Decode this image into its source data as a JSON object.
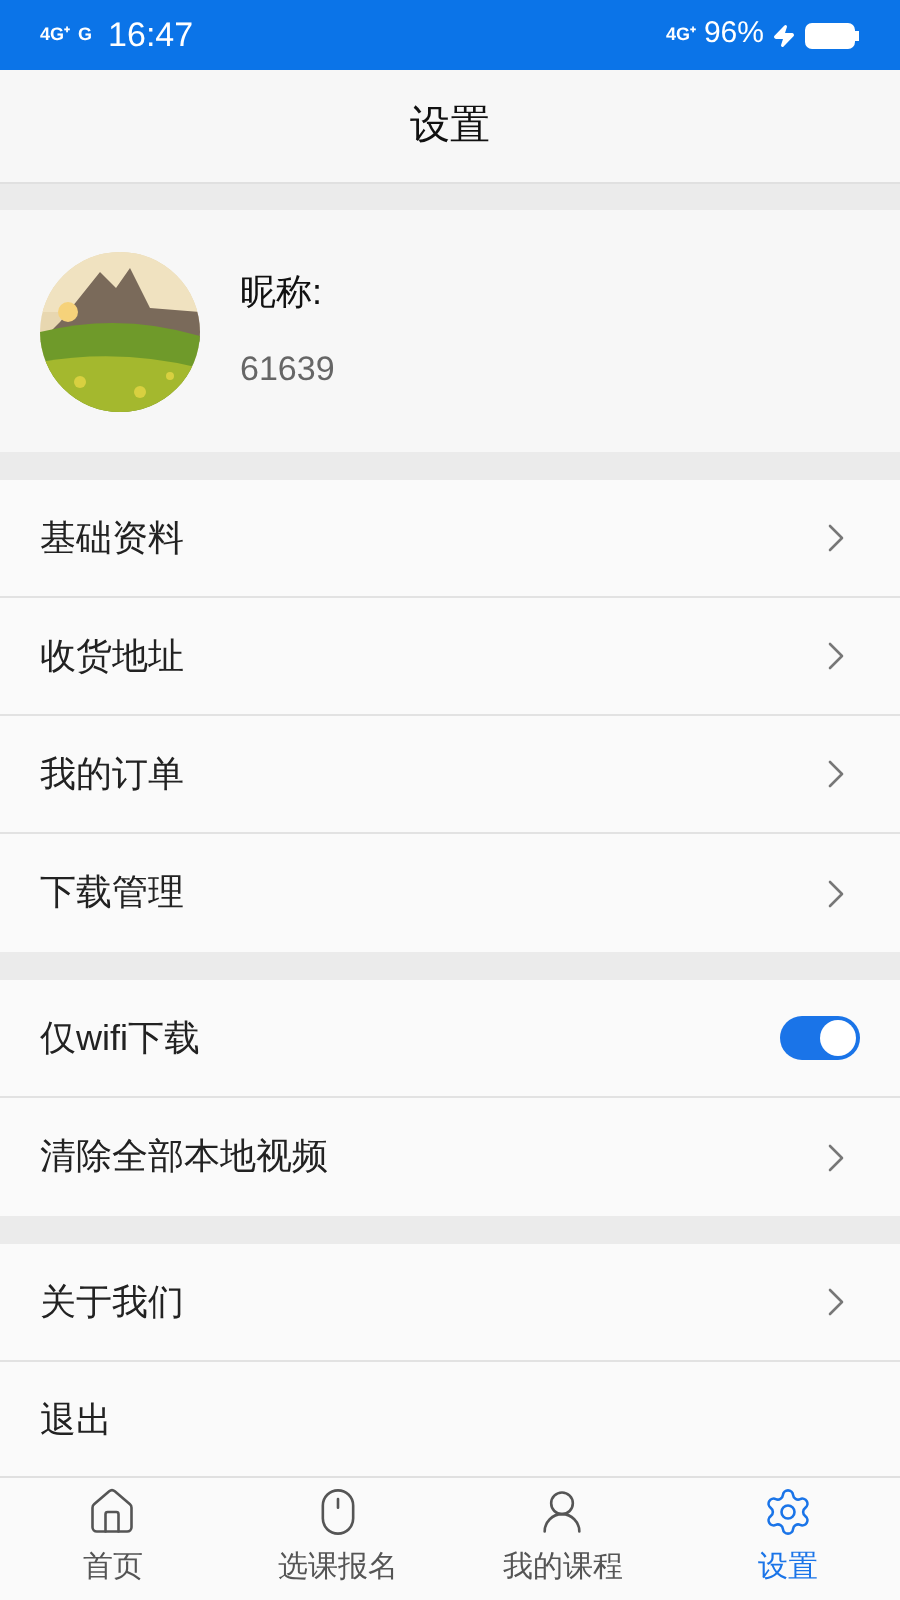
{
  "status_bar": {
    "network_left": "4G⁺",
    "network_right": "G",
    "time": "16:47",
    "network_status": "4G⁺",
    "battery": "96%"
  },
  "header": {
    "title": "设置"
  },
  "profile": {
    "nickname_label": "昵称:",
    "user_id": "61639"
  },
  "groups": [
    {
      "items": [
        {
          "kind": "link",
          "label": "基础资料"
        },
        {
          "kind": "link",
          "label": "收货地址"
        },
        {
          "kind": "link",
          "label": "我的订单"
        },
        {
          "kind": "link",
          "label": "下载管理"
        }
      ]
    },
    {
      "items": [
        {
          "kind": "toggle",
          "label": "仅wifi下载",
          "on": true
        },
        {
          "kind": "link",
          "label": "清除全部本地视频"
        }
      ]
    },
    {
      "items": [
        {
          "kind": "link",
          "label": "关于我们"
        },
        {
          "kind": "plain",
          "label": "退出"
        }
      ]
    }
  ],
  "tab_bar": [
    {
      "label": "首页",
      "selected": false
    },
    {
      "label": "选课报名",
      "selected": false
    },
    {
      "label": "我的课程",
      "selected": false
    },
    {
      "label": "设置",
      "selected": true
    }
  ]
}
